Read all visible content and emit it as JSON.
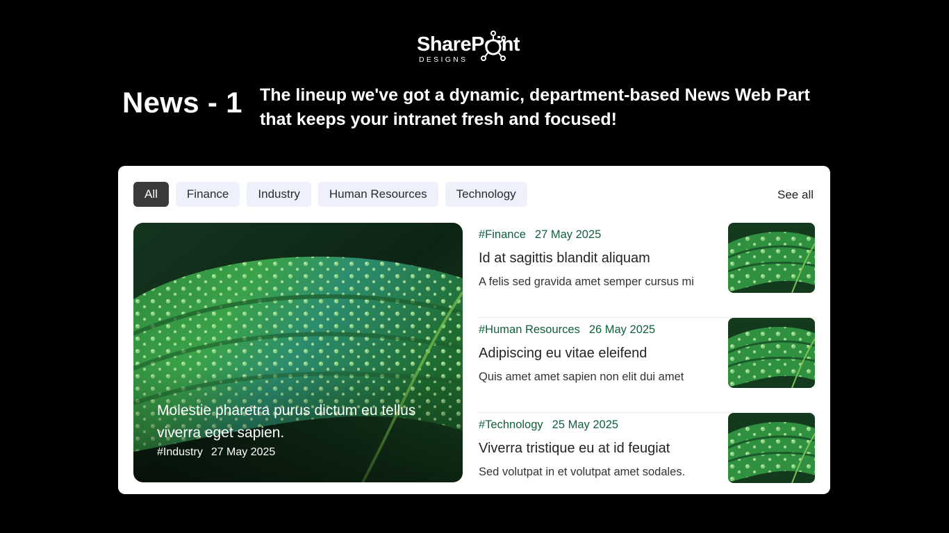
{
  "brand": {
    "name": "SharePoint",
    "tagline": "DESIGNS"
  },
  "page": {
    "title": "News - 1",
    "tagline": "The lineup we've got a dynamic, department-based News Web Part that keeps your intranet fresh and focused!"
  },
  "filters": [
    {
      "label": "All",
      "active": true
    },
    {
      "label": "Finance",
      "active": false
    },
    {
      "label": "Industry",
      "active": false
    },
    {
      "label": "Human Resources",
      "active": false
    },
    {
      "label": "Technology",
      "active": false
    }
  ],
  "see_all_label": "See all",
  "featured": {
    "title": "Molestie pharetra purus dictum eu tellus viverra eget sapien.",
    "category": "#Industry",
    "date": "27 May 2025",
    "image": "green-leaf-water-droplets"
  },
  "articles": [
    {
      "category": "#Finance",
      "date": "27 May 2025",
      "title": "Id at sagittis blandit aliquam",
      "excerpt": "A felis sed gravida amet semper cursus mi",
      "image": "green-leaf-water-droplets"
    },
    {
      "category": "#Human Resources",
      "date": "26 May 2025",
      "title": "Adipiscing eu vitae eleifend",
      "excerpt": "Quis amet amet sapien non elit dui amet",
      "image": "green-leaf-water-droplets"
    },
    {
      "category": "#Technology",
      "date": "25 May 2025",
      "title": "Viverra tristique eu at id feugiat",
      "excerpt": "Sed volutpat in et volutpat amet sodales.",
      "image": "green-leaf-water-droplets"
    }
  ],
  "colors": {
    "background": "#000000",
    "card": "#ffffff",
    "chip": "#eef1fb",
    "chip_active": "#3a3a3c",
    "category_text": "#0f5f3d"
  }
}
